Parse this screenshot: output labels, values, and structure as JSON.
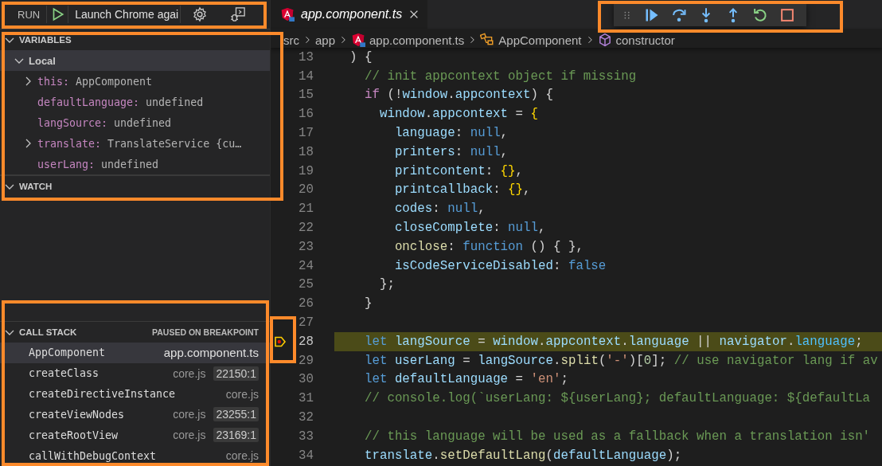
{
  "sidebar": {
    "toolbar": {
      "title": "RUN",
      "configuration": "Launch Chrome agai"
    },
    "sections": [
      {
        "kind": "variables",
        "title": "VARIABLES",
        "expanded": true,
        "scopes": [
          {
            "name": "Local",
            "expanded": true,
            "selected": true,
            "children": [
              {
                "name": "this:",
                "value": "AppComponent",
                "kind": "object"
              },
              {
                "name": "defaultLanguage:",
                "value": "undefined",
                "kind": "value"
              },
              {
                "name": "langSource:",
                "value": "undefined",
                "kind": "value"
              },
              {
                "name": "translate:",
                "value": "TranslateService {cu…",
                "kind": "object"
              },
              {
                "name": "userLang:",
                "value": "undefined",
                "kind": "value"
              }
            ]
          }
        ]
      },
      {
        "kind": "watch",
        "title": "WATCH",
        "expanded": true
      },
      {
        "kind": "call_stack",
        "title": "CALL STACK",
        "expanded": true,
        "status": "PAUSED ON BREAKPOINT",
        "frames": [
          {
            "name": "AppComponent",
            "file": "app.component.ts",
            "selected": true
          },
          {
            "name": "createClass",
            "file": "core.js",
            "line": "22150:1",
            "selected": false
          },
          {
            "name": "createDirectiveInstance",
            "file": "core.js",
            "selected": false
          },
          {
            "name": "createViewNodes",
            "file": "core.js",
            "line": "23255:1",
            "selected": false
          },
          {
            "name": "createRootView",
            "file": "core.js",
            "line": "23169:1",
            "selected": false
          },
          {
            "name": "callWithDebugContext",
            "file": "core.js",
            "selected": false
          }
        ]
      }
    ]
  },
  "editor": {
    "tabs": [
      {
        "label": "app.component.ts",
        "selected": true,
        "preview": true
      }
    ],
    "debug_toolbar": [
      {
        "kind": "continue"
      },
      {
        "kind": "step-over"
      },
      {
        "kind": "step-into"
      },
      {
        "kind": "step-out"
      },
      {
        "kind": "restart"
      },
      {
        "kind": "stop"
      }
    ],
    "breadcrumbs": [
      {
        "label": "src",
        "kind": "folder"
      },
      {
        "label": "app",
        "kind": "folder"
      },
      {
        "label": "app.component.ts",
        "kind": "file"
      },
      {
        "label": "AppComponent",
        "kind": "class"
      },
      {
        "label": "constructor",
        "kind": "method"
      }
    ],
    "lines": [
      {
        "number": "13",
        "current": false,
        "tokens": [
          {
            "text": ") {",
            "kind": "punc"
          }
        ]
      },
      {
        "number": "14",
        "current": false,
        "tokens": [
          {
            "text": "  // init appcontext object if missing",
            "kind": "comment"
          }
        ]
      },
      {
        "number": "15",
        "current": false,
        "tokens": [
          {
            "text": "  if",
            "kind": "control"
          },
          {
            "text": " (!",
            "kind": "punc"
          },
          {
            "text": "window",
            "kind": "var"
          },
          {
            "text": ".",
            "kind": "punc"
          },
          {
            "text": "appcontext",
            "kind": "var"
          },
          {
            "text": ") {",
            "kind": "punc"
          }
        ]
      },
      {
        "number": "16",
        "current": false,
        "tokens": [
          {
            "text": "    window",
            "kind": "var"
          },
          {
            "text": ".",
            "kind": "punc"
          },
          {
            "text": "appcontext",
            "kind": "var"
          },
          {
            "text": " = ",
            "kind": "punc"
          },
          {
            "text": "{",
            "kind": "brace"
          }
        ]
      },
      {
        "number": "17",
        "current": false,
        "tokens": [
          {
            "text": "      language",
            "kind": "var"
          },
          {
            "text": ": ",
            "kind": "punc"
          },
          {
            "text": "null",
            "kind": "keyword"
          },
          {
            "text": ",",
            "kind": "punc"
          }
        ]
      },
      {
        "number": "18",
        "current": false,
        "tokens": [
          {
            "text": "      printers",
            "kind": "var"
          },
          {
            "text": ": ",
            "kind": "punc"
          },
          {
            "text": "null",
            "kind": "keyword"
          },
          {
            "text": ",",
            "kind": "punc"
          }
        ]
      },
      {
        "number": "19",
        "current": false,
        "tokens": [
          {
            "text": "      printcontent",
            "kind": "var"
          },
          {
            "text": ": ",
            "kind": "punc"
          },
          {
            "text": "{}",
            "kind": "brace"
          },
          {
            "text": ",",
            "kind": "punc"
          }
        ]
      },
      {
        "number": "20",
        "current": false,
        "tokens": [
          {
            "text": "      printcallback",
            "kind": "var"
          },
          {
            "text": ": ",
            "kind": "punc"
          },
          {
            "text": "{}",
            "kind": "brace"
          },
          {
            "text": ",",
            "kind": "punc"
          }
        ]
      },
      {
        "number": "21",
        "current": false,
        "tokens": [
          {
            "text": "      codes",
            "kind": "var"
          },
          {
            "text": ": ",
            "kind": "punc"
          },
          {
            "text": "null",
            "kind": "keyword"
          },
          {
            "text": ",",
            "kind": "punc"
          }
        ]
      },
      {
        "number": "22",
        "current": false,
        "tokens": [
          {
            "text": "      closeComplete",
            "kind": "var"
          },
          {
            "text": ": ",
            "kind": "punc"
          },
          {
            "text": "null",
            "kind": "keyword"
          },
          {
            "text": ",",
            "kind": "punc"
          }
        ]
      },
      {
        "number": "23",
        "current": false,
        "tokens": [
          {
            "text": "      onclose",
            "kind": "func"
          },
          {
            "text": ": ",
            "kind": "punc"
          },
          {
            "text": "function",
            "kind": "keyword"
          },
          {
            "text": " () { },",
            "kind": "punc"
          }
        ]
      },
      {
        "number": "24",
        "current": false,
        "tokens": [
          {
            "text": "      isCodeServiceDisabled",
            "kind": "var"
          },
          {
            "text": ": ",
            "kind": "punc"
          },
          {
            "text": "false",
            "kind": "keyword"
          }
        ]
      },
      {
        "number": "25",
        "current": false,
        "tokens": [
          {
            "text": "    };",
            "kind": "punc"
          }
        ]
      },
      {
        "number": "26",
        "current": false,
        "tokens": [
          {
            "text": "  }",
            "kind": "punc"
          }
        ]
      },
      {
        "number": "27",
        "current": false
      },
      {
        "number": "28",
        "current": true,
        "tokens": [
          {
            "text": "  let ",
            "kind": "keyword"
          },
          {
            "text": "langSource",
            "kind": "var"
          },
          {
            "text": " = ",
            "kind": "punc"
          },
          {
            "text": "window",
            "kind": "var"
          },
          {
            "text": ".",
            "kind": "punc"
          },
          {
            "text": "appcontext",
            "kind": "var"
          },
          {
            "text": ".",
            "kind": "punc"
          },
          {
            "text": "language",
            "kind": "var"
          },
          {
            "text": " || ",
            "kind": "punc"
          },
          {
            "text": "navigator",
            "kind": "var"
          },
          {
            "text": ".",
            "kind": "punc"
          },
          {
            "text": "language",
            "kind": "prop"
          },
          {
            "text": ";",
            "kind": "punc"
          }
        ]
      },
      {
        "number": "29",
        "current": false,
        "tokens": [
          {
            "text": "  let ",
            "kind": "keyword"
          },
          {
            "text": "userLang",
            "kind": "var"
          },
          {
            "text": " = ",
            "kind": "punc"
          },
          {
            "text": "langSource",
            "kind": "var"
          },
          {
            "text": ".",
            "kind": "punc"
          },
          {
            "text": "split",
            "kind": "func"
          },
          {
            "text": "(",
            "kind": "punc"
          },
          {
            "text": "'-'",
            "kind": "string"
          },
          {
            "text": ")[",
            "kind": "punc"
          },
          {
            "text": "0",
            "kind": "number"
          },
          {
            "text": "]; ",
            "kind": "punc"
          },
          {
            "text": "// use navigator lang if av",
            "kind": "comment"
          }
        ]
      },
      {
        "number": "30",
        "current": false,
        "tokens": [
          {
            "text": "  let ",
            "kind": "keyword"
          },
          {
            "text": "defaultLanguage",
            "kind": "var"
          },
          {
            "text": " = ",
            "kind": "punc"
          },
          {
            "text": "'en'",
            "kind": "string"
          },
          {
            "text": ";",
            "kind": "punc"
          }
        ]
      },
      {
        "number": "31",
        "current": false,
        "tokens": [
          {
            "text": "  // console.log(`userLang: ${userLang}; defaultLanguage: ${defaultLa",
            "kind": "comment"
          }
        ]
      },
      {
        "number": "32",
        "current": false
      },
      {
        "number": "33",
        "current": false,
        "tokens": [
          {
            "text": "  // this language will be used as a fallback when a translation isn'",
            "kind": "comment"
          }
        ]
      },
      {
        "number": "34",
        "current": false,
        "tokens": [
          {
            "text": "  translate",
            "kind": "var"
          },
          {
            "text": ".",
            "kind": "punc"
          },
          {
            "text": "setDefaultLang",
            "kind": "func"
          },
          {
            "text": "(",
            "kind": "punc"
          },
          {
            "text": "defaultLanguage",
            "kind": "var"
          },
          {
            "text": ");",
            "kind": "punc"
          }
        ]
      }
    ]
  }
}
